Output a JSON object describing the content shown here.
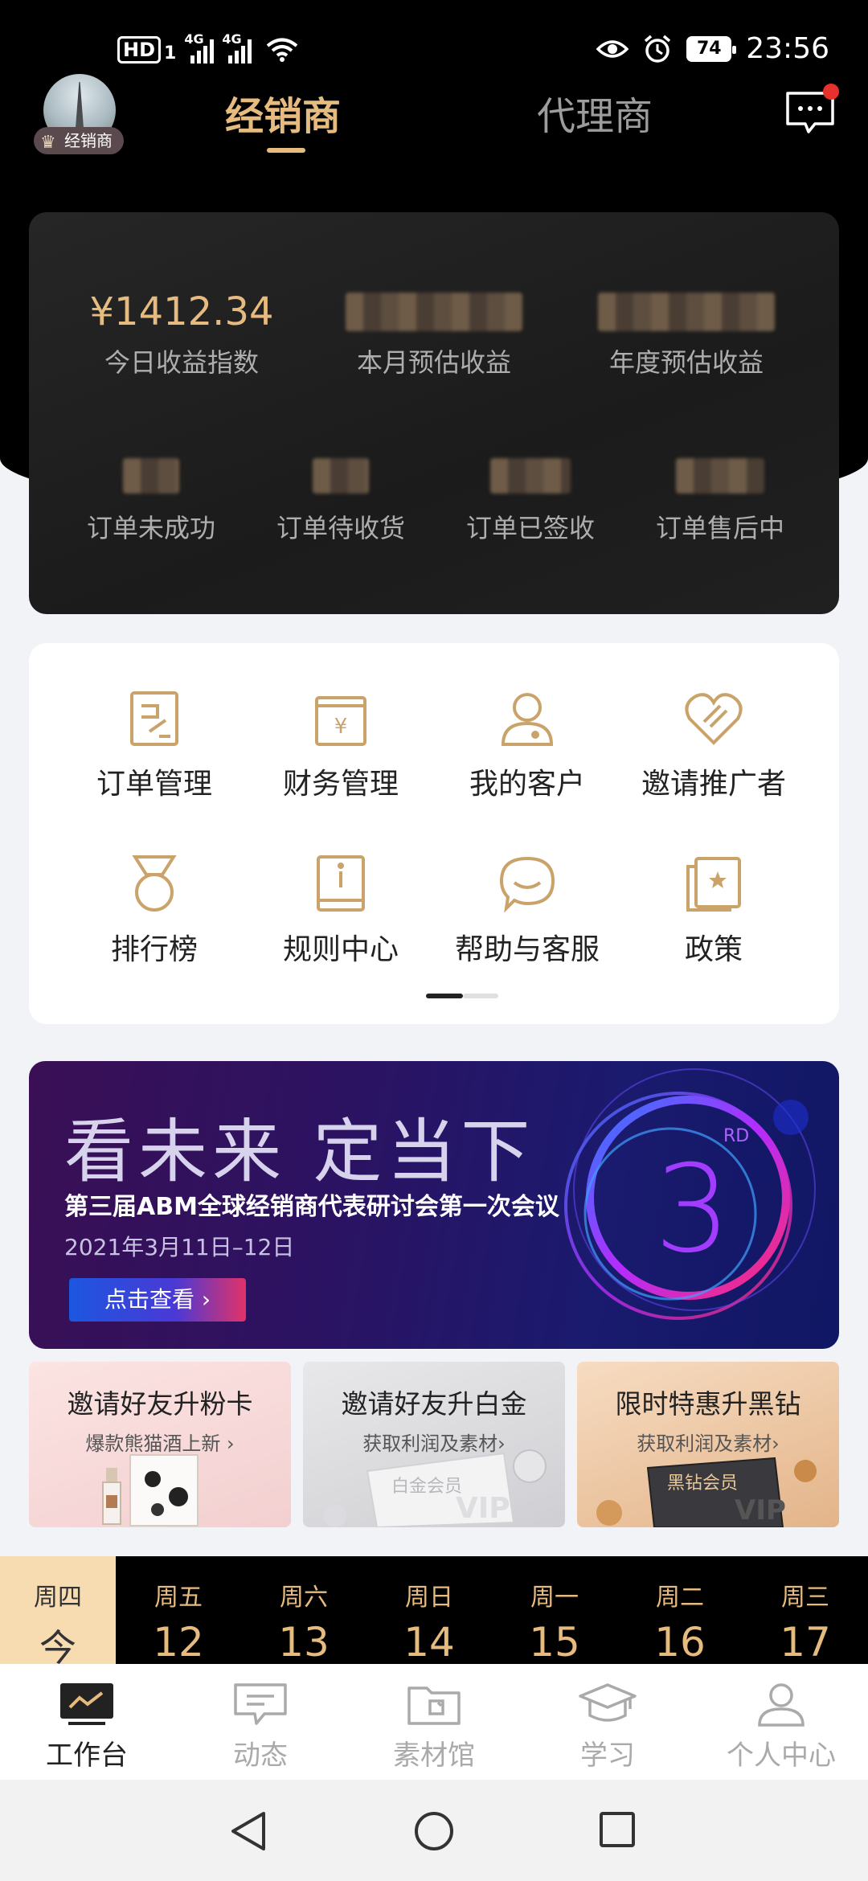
{
  "status_bar": {
    "hd": "HD",
    "sim": "1",
    "net1": "4G",
    "net2": "4G",
    "battery": "74",
    "time": "23:56"
  },
  "header": {
    "role_badge": "经销商",
    "tabs": [
      {
        "label": "经销商",
        "active": true
      },
      {
        "label": "代理商",
        "active": false
      }
    ]
  },
  "earnings": {
    "top": [
      {
        "value": "¥1412.34",
        "label": "今日收益指数"
      },
      {
        "value": "",
        "label": "本月预估收益"
      },
      {
        "value": "",
        "label": "年度预估收益"
      }
    ],
    "orders": [
      {
        "label": "订单未成功"
      },
      {
        "label": "订单待收货"
      },
      {
        "label": "订单已签收"
      },
      {
        "label": "订单售后中"
      }
    ]
  },
  "menu": {
    "items": [
      {
        "label": "订单管理",
        "icon": "order-icon"
      },
      {
        "label": "财务管理",
        "icon": "finance-icon"
      },
      {
        "label": "我的客户",
        "icon": "customer-icon"
      },
      {
        "label": "邀请推广者",
        "icon": "invite-heart-icon"
      },
      {
        "label": "排行榜",
        "icon": "medal-icon"
      },
      {
        "label": "规则中心",
        "icon": "rules-book-icon"
      },
      {
        "label": "帮助与客服",
        "icon": "support-icon"
      },
      {
        "label": "政策",
        "icon": "policy-icon"
      }
    ]
  },
  "banner": {
    "headline": "看未来 定当下",
    "subtitle": "第三届ABM全球经销商代表研讨会第一次会议",
    "date": "2021年3月11日–12日",
    "cta": "点击查看 ›",
    "badge_num": "3",
    "badge_sup": "RD"
  },
  "promos": [
    {
      "title": "邀请好友升粉卡",
      "sub": "爆款熊猫酒上新 ›"
    },
    {
      "title": "邀请好友升白金",
      "sub": "获取利润及素材›",
      "card_text": "白金会员"
    },
    {
      "title": "限时特惠升黑钻",
      "sub": "获取利润及素材›",
      "card_text": "黑钻会员"
    }
  ],
  "week": [
    {
      "name": "周四",
      "date": "今",
      "today": true
    },
    {
      "name": "周五",
      "date": "12"
    },
    {
      "name": "周六",
      "date": "13"
    },
    {
      "name": "周日",
      "date": "14"
    },
    {
      "name": "周一",
      "date": "15"
    },
    {
      "name": "周二",
      "date": "16"
    },
    {
      "name": "周三",
      "date": "17"
    }
  ],
  "bottom_nav": [
    {
      "label": "工作台",
      "icon": "workbench-icon",
      "active": true
    },
    {
      "label": "动态",
      "icon": "feed-icon"
    },
    {
      "label": "素材馆",
      "icon": "material-folder-icon"
    },
    {
      "label": "学习",
      "icon": "graduation-cap-icon"
    },
    {
      "label": "个人中心",
      "icon": "profile-icon"
    }
  ],
  "colors": {
    "accent_gold": "#e6bb7f",
    "icon_gold": "#c9a36a",
    "today_bg": "#f7dbb1",
    "notify_red": "#e8302d"
  }
}
